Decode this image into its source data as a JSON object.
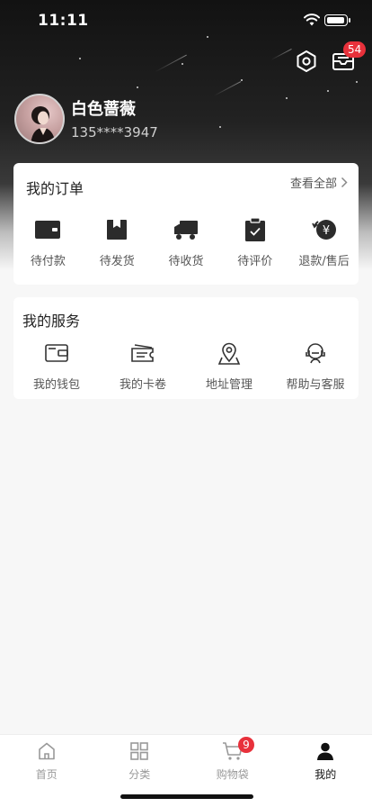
{
  "status_bar": {
    "time": "11:11"
  },
  "header": {
    "messages_badge": "54"
  },
  "profile": {
    "name": "白色蔷薇",
    "phone": "135****3947"
  },
  "orders": {
    "title": "我的订单",
    "view_all": "查看全部",
    "items": [
      {
        "label": "待付款",
        "icon": "wallet-icon"
      },
      {
        "label": "待发货",
        "icon": "box-icon"
      },
      {
        "label": "待收货",
        "icon": "truck-icon"
      },
      {
        "label": "待评价",
        "icon": "clipboard-check-icon"
      },
      {
        "label": "退款/售后",
        "icon": "refund-yen-icon"
      }
    ]
  },
  "services": {
    "title": "我的服务",
    "items": [
      {
        "label": "我的钱包",
        "icon": "wallet-outline-icon"
      },
      {
        "label": "我的卡卷",
        "icon": "ticket-icon"
      },
      {
        "label": "地址管理",
        "icon": "location-icon"
      },
      {
        "label": "帮助与客服",
        "icon": "headset-icon"
      }
    ]
  },
  "tabbar": {
    "items": [
      {
        "label": "首页",
        "icon": "home-icon"
      },
      {
        "label": "分类",
        "icon": "grid-icon"
      },
      {
        "label": "购物袋",
        "icon": "cart-icon",
        "badge": "9"
      },
      {
        "label": "我的",
        "icon": "user-icon",
        "active": true
      }
    ]
  },
  "colors": {
    "accent": "#e8313b",
    "dark": "#222222"
  }
}
